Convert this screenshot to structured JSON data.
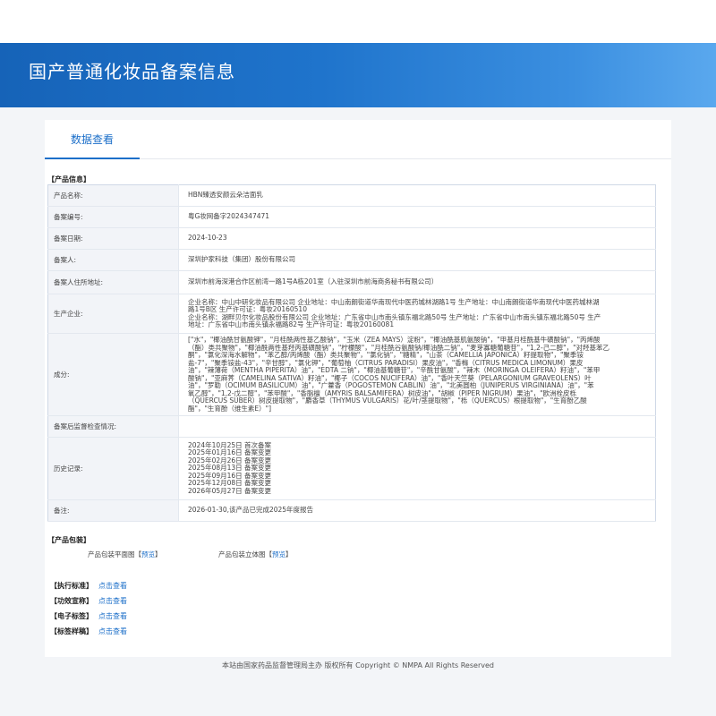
{
  "header": {
    "title": "国产普通化妆品备案信息"
  },
  "tabs": [
    {
      "label": "数据查看",
      "active": true
    }
  ],
  "product_section": {
    "title": "【产品信息】",
    "rows": [
      {
        "label": "产品名称:",
        "value": "HBN臻透安颜云朵洁面乳"
      },
      {
        "label": "备案编号:",
        "value": "粤G妆网备字2024347471"
      },
      {
        "label": "备案日期:",
        "value": "2024-10-23"
      },
      {
        "label": "备案人:",
        "value": "深圳护家科技（集团）股份有限公司"
      },
      {
        "label": "备案人住所地址:",
        "value": "深圳市前海深港合作区前湾一路1号A栋201室（入驻深圳市前海商务秘书有限公司）"
      },
      {
        "label": "生产企业:",
        "lines": [
          "企业名称：中山中研化妆品有限公司 企业地址：中山南朗街道华南现代中医药城林湖路1号 生产地址：中山南朗街道华南现代中医药城林湖",
          "路1号B区 生产许可证：粤妆20160510",
          "企业名称：湖畔贝尔化妆品股份有限公司 企业地址：广东省中山市南头镇东福北路50号 生产地址：广东省中山市南头镇东福北路50号 生产",
          "地址：广东省中山市南头镇永福路82号 生产许可证：粤妆20160081"
        ]
      },
      {
        "label": "成分:",
        "lines": [
          "[\"水\"，\"椰油酰甘氨酸钾\"，\"月桂酰两性基乙酸钠\"，\"玉米（ZEA MAYS）淀粉\"，\"椰油酰基肌氨酸钠\"，\"甲基月桂酰基牛磺酸钠\"，\"丙烯酸",
          "（酯）类共聚物\"，\"椰油酰两性基羟丙基磺酸钠\"，\"柠檬酸\"，\"月桂酰谷氨酸钠/椰油酰二钠\"，\"麦芽寡糖葡糖苷\"，\"1,2-己二醇\"，\"对羟基苯乙",
          "酮\"，\"氯化深海水解物\"，\"苯乙醇/丙烯酸（酯）类共聚物\"，\"氯化钠\"，\"糖精\"，\"山茶（CAMELLIA JAPONICA）籽提取物\"，\"聚季铵",
          "盐-7\"，\"聚季铵盐-43\"，\"辛甘醇\"，\"氯化钾\"，\"葡萄柚（CITRUS PARADISI）果皮油\"，\"香橼（CITRUS MEDICA LIMONUM）果皮",
          "油\"，\"辣薄荷（MENTHA PIPERITA）油\"，\"EDTA 二钠\"，\"椰油基葡糖苷\"，\"辛酰甘氨酸\"，\"辣木（MORINGA OLEIFERA）籽油\"，\"苯甲",
          "酸钠\"，\"亚麻荠（CAMELINA SATIVA）籽油\"，\"椰子（COCOS NUCIFERA）油\"，\"香叶天竺葵（PELARGONIUM GRAVEOLENS）叶",
          "油\"，\"罗勒（OCIMUM BASILICUM）油\"，\"广藿香（POGOSTEMON CABLIN）油\"，\"北美圆柏（JUNIPERUS VIRGINIANA）油\"，\"苯",
          "氧乙醇\"，\"1,2-戊二醇\"，\"苯甲酸\"，\"香脂檀（AMYRIS BALSAMIFERA）树皮油\"，\"胡椒（PIPER NIGRUM）果油\"，\"欧洲栓皮栎",
          "（QUERCUS SUBER）树皮提取物\"，\"麝香草（THYMUS VULGARIS）花/叶/茎提取物\"，\"栎（QUERCUS）根提取物\"，\"生育酚乙酸",
          "酯\"，\"生育酚（维生素E）\"]"
        ]
      },
      {
        "label": "备案后监督检查情况:",
        "value": ""
      },
      {
        "label": "历史记录:",
        "lines": [
          "2024年10月25日 首次备案",
          "2025年01月16日 备案变更",
          "2025年02月26日 备案变更",
          "2025年08月13日 备案变更",
          "2025年09月16日 备案变更",
          "2025年12月08日 备案变更",
          "2026年05月27日 备案变更"
        ]
      },
      {
        "label": "备注:",
        "value": "2026-01-30,该产品已完成2025年度报告"
      }
    ]
  },
  "packaging": {
    "title": "【产品包装】",
    "flat_label": "产品包装平面图",
    "flat_link": "预览",
    "stereo_label": "产品包装立体图",
    "stereo_link": "预览",
    "bracket_open": "【",
    "bracket_close": "】"
  },
  "documents": [
    {
      "label": "【执行标准】",
      "link": "点击查看"
    },
    {
      "label": "【功效宣称】",
      "link": "点击查看"
    },
    {
      "label": "【电子标签】",
      "link": "点击查看"
    },
    {
      "label": "【标签样稿】",
      "link": "点击查看"
    }
  ],
  "footer": {
    "text": "本站由国家药品监督管理局主办 版权所有 Copyright © NMPA All Rights Reserved"
  }
}
